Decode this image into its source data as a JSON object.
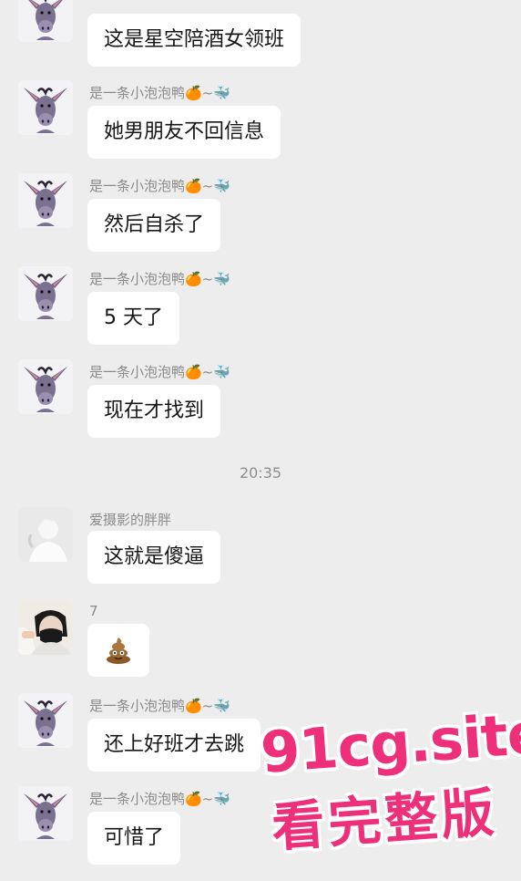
{
  "messages": [
    {
      "sender": "",
      "text": "这是星空陪酒女领班",
      "avatar": "donkey-avatar"
    },
    {
      "sender": "是一条小泡泡鸭🍊~🐳",
      "text": "她男朋友不回信息",
      "avatar": "donkey-avatar"
    },
    {
      "sender": "是一条小泡泡鸭🍊~🐳",
      "text": "然后自杀了",
      "avatar": "donkey-avatar"
    },
    {
      "sender": "是一条小泡泡鸭🍊~🐳",
      "text": "5 天了",
      "avatar": "donkey-avatar"
    },
    {
      "sender": "是一条小泡泡鸭🍊~🐳",
      "text": "现在才找到",
      "avatar": "donkey-avatar"
    },
    {
      "sender": "爱摄影的胖胖",
      "text": "这就是傻逼",
      "avatar": "person-gray-avatar"
    },
    {
      "sender": "7",
      "text": "💩",
      "avatar": "masked-person-avatar"
    },
    {
      "sender": "是一条小泡泡鸭🍊~🐳",
      "text": "还上好班才去跳",
      "avatar": "donkey-avatar"
    },
    {
      "sender": "是一条小泡泡鸭🍊~🐳",
      "text": "可惜了",
      "avatar": "donkey-avatar"
    }
  ],
  "timestamp": "20:35",
  "watermark": {
    "line1": "91cg.site",
    "line2": "看完整版",
    "color": "#ee2f7a"
  },
  "colors": {
    "background": "#ededed",
    "bubble": "#ffffff",
    "meta_text": "#8a8a8a"
  }
}
